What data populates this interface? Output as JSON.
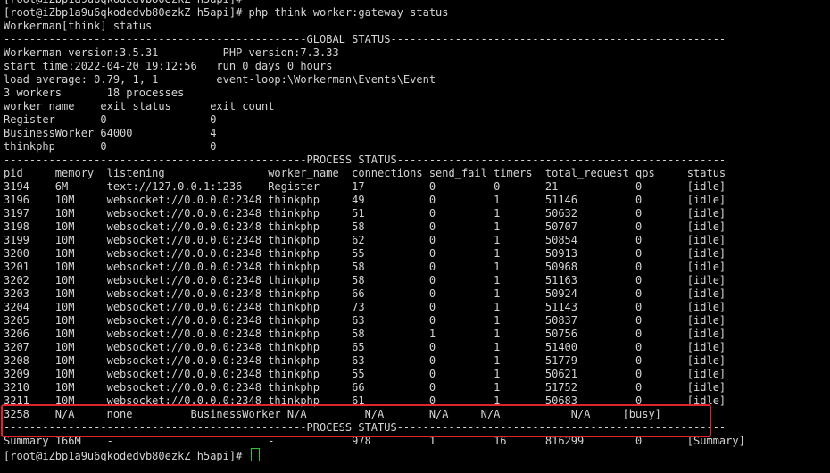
{
  "terminal": {
    "prompt": "[root@iZbp1a9u6qkodedvb80ezkZ h5api]# ",
    "lines": [
      "[root@iZbp1a9u6qkodedvb80ezkZ h5api]#",
      "[root@iZbp1a9u6qkodedvb80ezkZ h5api]# php think worker:gateway status",
      "Workerman[think] status",
      "-----------------------------------------------GLOBAL STATUS----------------------------------------------------",
      "Workerman version:3.5.31          PHP version:7.3.33",
      "start time:2022-04-20 19:12:56   run 0 days 0 hours",
      "load average: 0.79, 1, 1         event-loop:\\Workerman\\Events\\Event",
      "3 workers       18 processes",
      "worker_name    exit_status      exit_count",
      "Register       0                0",
      "BusinessWorker 64000            4",
      "thinkphp       0                0",
      "-----------------------------------------------PROCESS STATUS---------------------------------------------------",
      "pid     memory  listening                worker_name  connections send_fail timers  total_request qps     status",
      "3194    6M      text://127.0.0.1:1236    Register     17          0         0       21            0       [idle]",
      "3196    10M     websocket://0.0.0.0:2348 thinkphp     49          0         1       51146         0       [idle]",
      "3197    10M     websocket://0.0.0.0:2348 thinkphp     51          0         1       50632         0       [idle]",
      "3198    10M     websocket://0.0.0.0:2348 thinkphp     58          0         1       50707         0       [idle]",
      "3199    10M     websocket://0.0.0.0:2348 thinkphp     62          0         1       50854         0       [idle]",
      "3200    10M     websocket://0.0.0.0:2348 thinkphp     55          0         1       50913         0       [idle]",
      "3201    10M     websocket://0.0.0.0:2348 thinkphp     58          0         1       50968         0       [idle]",
      "3202    10M     websocket://0.0.0.0:2348 thinkphp     58          0         1       51163         0       [idle]",
      "3203    10M     websocket://0.0.0.0:2348 thinkphp     66          0         1       50924         0       [idle]",
      "3204    10M     websocket://0.0.0.0:2348 thinkphp     73          0         1       51143         0       [idle]",
      "3205    10M     websocket://0.0.0.0:2348 thinkphp     63          0         1       50837         0       [idle]",
      "3206    10M     websocket://0.0.0.0:2348 thinkphp     58          1         1       50756         0       [idle]",
      "3207    10M     websocket://0.0.0.0:2348 thinkphp     65          0         1       51400         0       [idle]",
      "3208    10M     websocket://0.0.0.0:2348 thinkphp     63          0         1       51779         0       [idle]",
      "3209    10M     websocket://0.0.0.0:2348 thinkphp     55          0         1       50621         0       [idle]",
      "3210    10M     websocket://0.0.0.0:2348 thinkphp     66          0         1       51752         0       [idle]",
      "3211    10M     websocket://0.0.0.0:2348 thinkphp     61          0         1       50683         0       [idle]",
      "3258    N/A     none         BusinessWorker N/A         N/A       N/A     N/A           N/A     [busy]",
      "-----------------------------------------------PROCESS STATUS---------------------------------------------------",
      "Summary 166M    -                        -            978         1         16      816299        0       [Summary]"
    ]
  }
}
